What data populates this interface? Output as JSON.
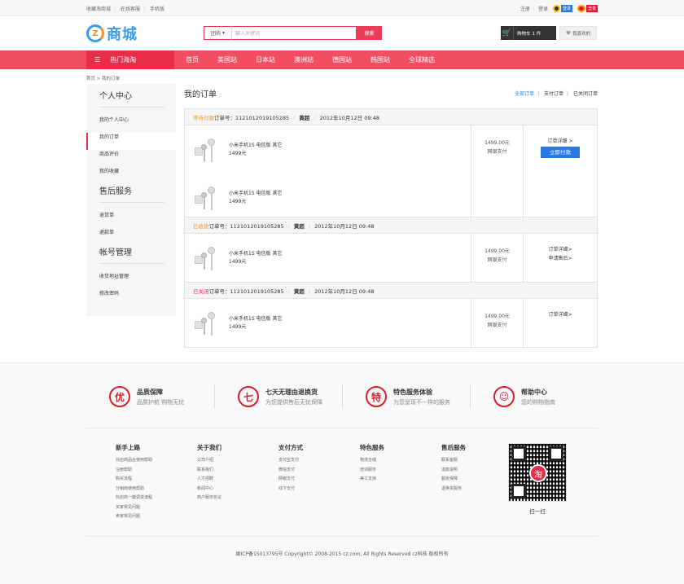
{
  "topbar": {
    "left": [
      "收藏淘商城",
      "在线客服",
      "手机版"
    ],
    "login_register": [
      "注册",
      "登录"
    ],
    "qq_badge": "登录",
    "weibo_badge": "登录"
  },
  "header": {
    "logo_mark": "Z",
    "logo_text": "商城",
    "search": {
      "select": "团购",
      "placeholder": "输入关键词",
      "button": "搜索"
    },
    "cart_label": "购物车",
    "cart_count": "1 件",
    "fav_label": "我喜欢的"
  },
  "nav": {
    "category": "热门海淘",
    "links": [
      "首页",
      "美国站",
      "日本站",
      "澳洲站",
      "德国站",
      "韩国站",
      "全球精选"
    ]
  },
  "breadcrumb": "首页 > 我的订单",
  "sidebar": {
    "sections": [
      {
        "title": "个人中心",
        "items": [
          "我的个人中心",
          "我的订单",
          "商品评价",
          "我的收藏"
        ]
      },
      {
        "title": "售后服务",
        "items": [
          "退货单",
          "退款单"
        ]
      },
      {
        "title": "帐号管理",
        "items": [
          "收货地址管理",
          "修改密码"
        ]
      }
    ]
  },
  "content": {
    "title": "我的订单",
    "tabs": [
      "全部订单",
      "支付订单",
      "已关闭订单"
    ],
    "orders": [
      {
        "status": "等待付款",
        "no_label": "订单号：1121012019105285",
        "user": "黄超",
        "date": "2012年10月12日 09:48",
        "goods": [
          {
            "name": "小米手机1S 电信版 其它",
            "price": "1499元"
          },
          {
            "name": "小米手机1S 电信版 其它",
            "price": "1499元"
          }
        ],
        "total": "1499.00元",
        "pay": "网银支付",
        "ops": [
          "订单详细 >"
        ],
        "pay_btn": "立即付款"
      },
      {
        "status": "已收货",
        "no_label": "订单号：1121012019105285",
        "user": "黄超",
        "date": "2012年10月12日 09:48",
        "goods": [
          {
            "name": "小米手机1S 电信版 其它",
            "price": "1499元"
          }
        ],
        "total": "1499.00元",
        "pay": "网银支付",
        "ops": [
          "订单详细>",
          "申请售后>"
        ]
      },
      {
        "status": "已关闭",
        "no_label": "订单号：1121012019105285",
        "user": "黄超",
        "date": "2012年10月12日 09:48",
        "goods": [
          {
            "name": "小米手机1S 电信版 其它",
            "price": "1499元"
          }
        ],
        "total": "1499.00元",
        "pay": "网银支付",
        "ops": [
          "订单详细>"
        ]
      }
    ]
  },
  "footer": {
    "guarantees": [
      {
        "icon": "优",
        "title": "品质保障",
        "sub": "品质护航 购物无忧"
      },
      {
        "icon": "七",
        "title": "七天无理由退换货",
        "sub": "为您提供售后无忧保障"
      },
      {
        "icon": "特",
        "title": "特色服务体验",
        "sub": "为您呈现不一样的服务"
      },
      {
        "icon": "☺",
        "title": "帮助中心",
        "sub": "您的购物指南"
      }
    ],
    "columns": [
      {
        "title": "新手上路",
        "items": [
          "抖店商品台使用帮助",
          "注册帮助",
          "购买流程",
          "分销商使用帮助",
          "抖店商一键调货流程",
          "买家常见问题",
          "卖家常见问题"
        ]
      },
      {
        "title": "关于我们",
        "items": [
          "公司介绍",
          "联系我们",
          "人才招聘",
          "新闻中心",
          "商户服务协议"
        ]
      },
      {
        "title": "支付方式",
        "items": [
          "支付宝支付",
          "微信支付",
          "网银支付",
          "线下支付"
        ]
      },
      {
        "title": "特色服务",
        "items": [
          "物流仓储",
          "培训服务",
          "美工支持"
        ]
      },
      {
        "title": "售后服务",
        "items": [
          "联系客服",
          "退款说明",
          "服务保障",
          "退换货服务"
        ]
      }
    ],
    "qr_center": "淘",
    "qr_label": "扫一扫",
    "copyright": "闽ICP备15013795号 Copyright© 2008-2015 cz.com, All Rights Reserved cz科技 版权所有"
  }
}
